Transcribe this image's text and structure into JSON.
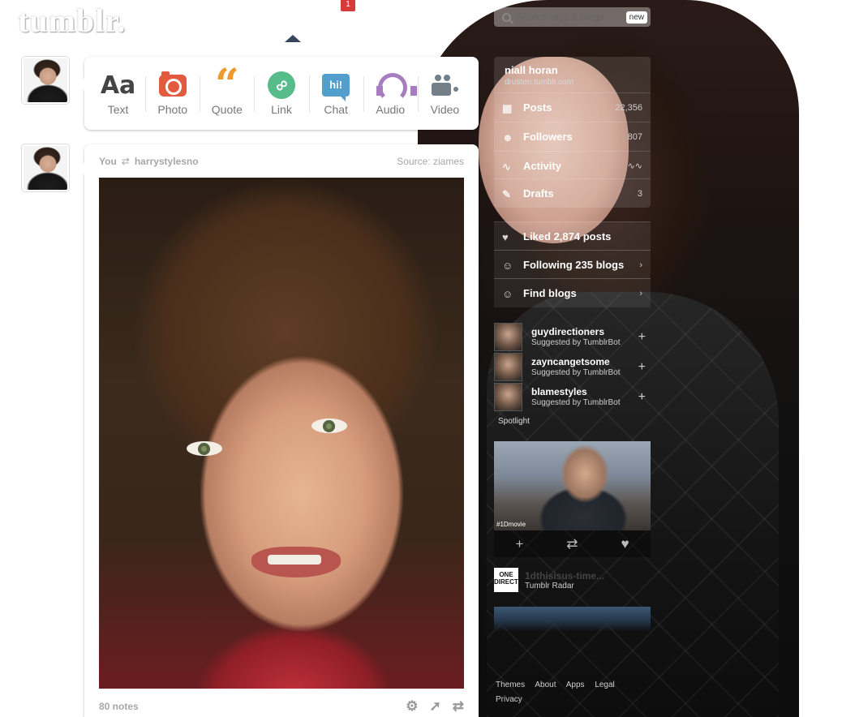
{
  "header": {
    "logo": "tumblr.",
    "notification_count": "1",
    "search_placeholder": "Search tags & blogs",
    "search_badge": "new"
  },
  "composer": {
    "types": [
      {
        "label": "Text",
        "icon": "text-icon"
      },
      {
        "label": "Photo",
        "icon": "photo-camera-icon"
      },
      {
        "label": "Quote",
        "icon": "quote-icon"
      },
      {
        "label": "Link",
        "icon": "link-icon"
      },
      {
        "label": "Chat",
        "icon": "chat-icon"
      },
      {
        "label": "Audio",
        "icon": "headphones-icon"
      },
      {
        "label": "Video",
        "icon": "video-camera-icon"
      }
    ],
    "chat_icon_text": "hi!"
  },
  "post": {
    "author": "You",
    "reblogged_from": "harrystylesno",
    "source": "Source: ziames",
    "notes": "80 notes"
  },
  "sidebar": {
    "blog_name": "niall horan",
    "blog_url": "drusten.tumblr.com",
    "stats": [
      {
        "label": "Posts",
        "value": "22,356"
      },
      {
        "label": "Followers",
        "value": "807"
      },
      {
        "label": "Activity",
        "value": ""
      },
      {
        "label": "Drafts",
        "value": "3"
      }
    ],
    "links": [
      {
        "label": "Liked 2,874 posts"
      },
      {
        "label": "Following 235 blogs"
      },
      {
        "label": "Find blogs"
      }
    ],
    "suggestions": [
      {
        "name": "guydirectioners",
        "sub": "Suggested by TumblrBot"
      },
      {
        "name": "zayncangetsome",
        "sub": "Suggested by TumblrBot"
      },
      {
        "name": "blamestyles",
        "sub": "Suggested by TumblrBot"
      }
    ],
    "spotlight_label": "Spotlight",
    "spotlight_tag": "#1Dmovie",
    "radar_logo": "ONE DIRECTION",
    "radar_title": "1dthisisus-time...",
    "radar_sub": "Tumblr Radar",
    "footer_links": [
      "Themes",
      "About",
      "Apps",
      "Legal",
      "Privacy"
    ]
  }
}
